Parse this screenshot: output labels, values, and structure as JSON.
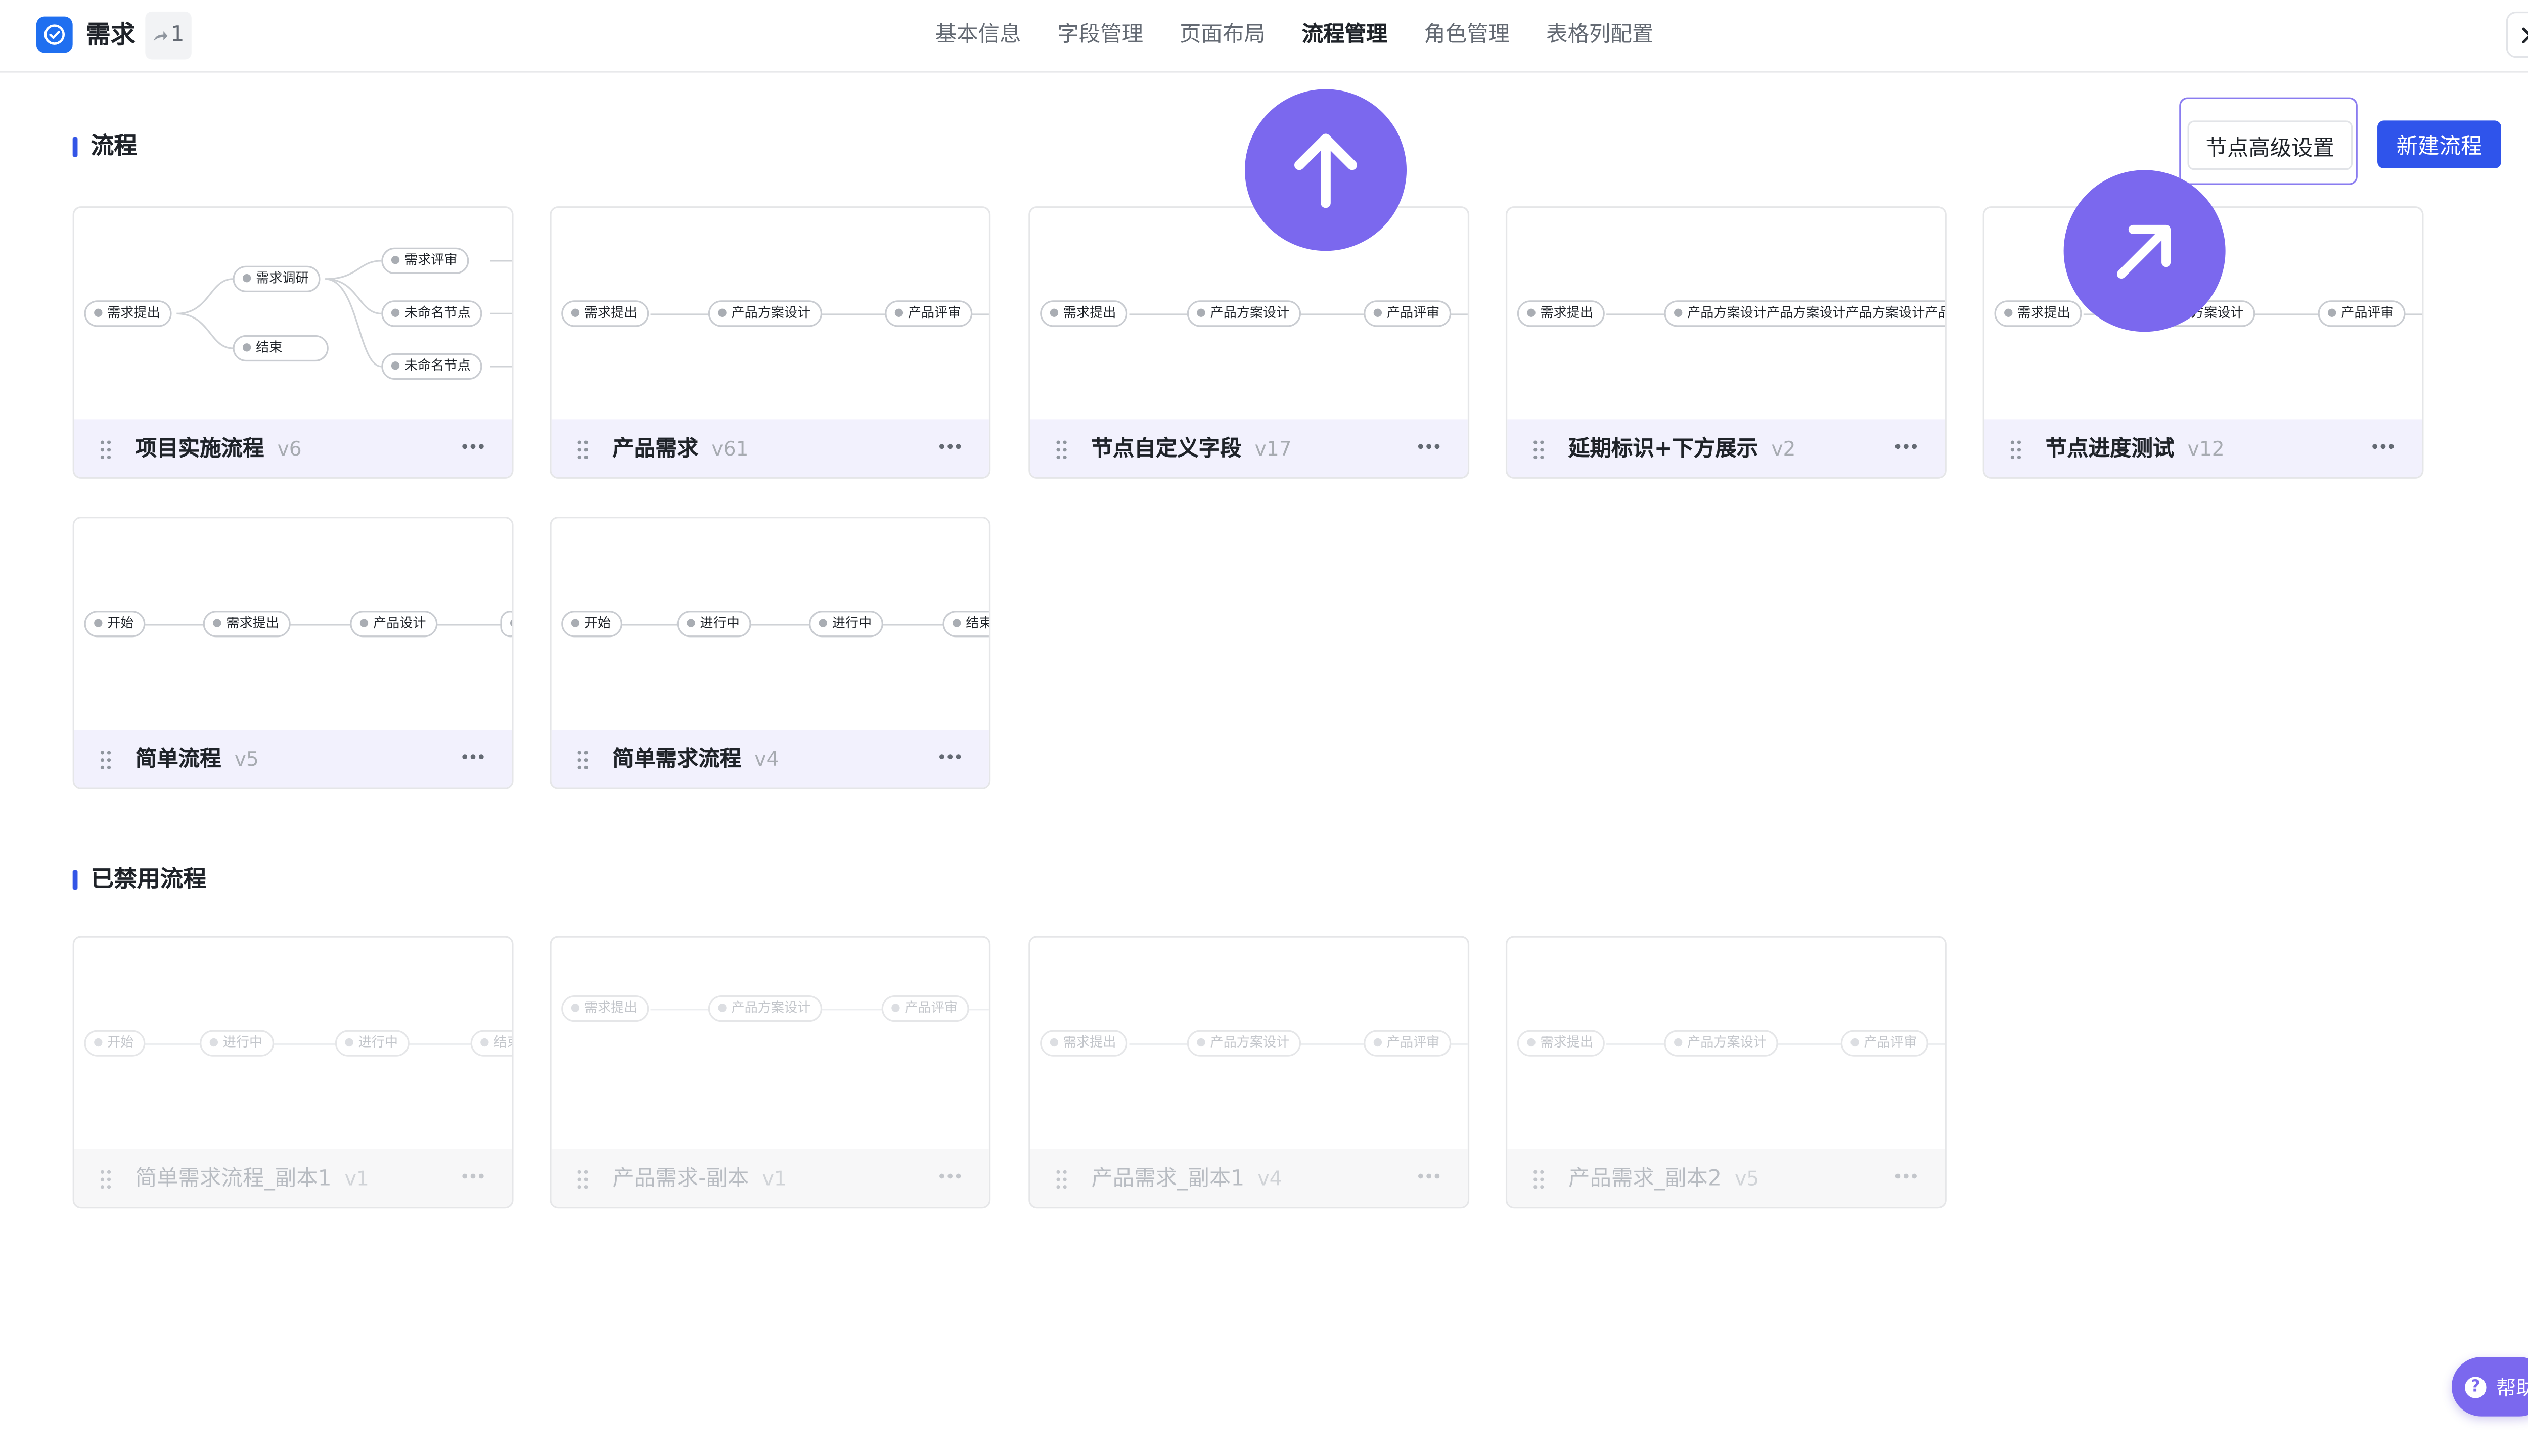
{
  "app": {
    "title": "需求",
    "share_count": "1"
  },
  "tabs": [
    {
      "label": "基本信息"
    },
    {
      "label": "字段管理"
    },
    {
      "label": "页面布局"
    },
    {
      "label": "流程管理"
    },
    {
      "label": "角色管理"
    },
    {
      "label": "表格列配置"
    }
  ],
  "active_tab": "流程管理",
  "sections": {
    "active": "流程",
    "disabled": "已禁用流程"
  },
  "buttons": {
    "advanced": "节点高级设置",
    "new_flow": "新建流程",
    "help": "帮助"
  },
  "flows": [
    {
      "name": "项目实施流程",
      "version": "v6",
      "nodes": [
        "需求提出",
        "需求调研",
        "结束",
        "需求评审",
        "未命名节点",
        "未命名节点"
      ]
    },
    {
      "name": "产品需求",
      "version": "v61",
      "nodes": [
        "需求提出",
        "产品方案设计",
        "产品评审"
      ]
    },
    {
      "name": "节点自定义字段",
      "version": "v17",
      "nodes": [
        "需求提出",
        "产品方案设计",
        "产品评审"
      ]
    },
    {
      "name": "延期标识+下方展示",
      "version": "v2",
      "nodes": [
        "需求提出",
        "产品方案设计产品方案设计产品方案设计产品方案设计"
      ]
    },
    {
      "name": "节点进度测试",
      "version": "v12",
      "nodes": [
        "需求提出",
        "产品方案设计",
        "产品评审"
      ]
    },
    {
      "name": "简单流程",
      "version": "v5",
      "nodes": [
        "开始",
        "需求提出",
        "产品设计"
      ]
    },
    {
      "name": "简单需求流程",
      "version": "v4",
      "nodes": [
        "开始",
        "进行中",
        "进行中",
        "结束"
      ]
    }
  ],
  "disabled_flows": [
    {
      "name": "简单需求流程_副本1",
      "version": "v1",
      "nodes": [
        "开始",
        "进行中",
        "进行中",
        "结束"
      ]
    },
    {
      "name": "产品需求-副本",
      "version": "v1",
      "nodes": [
        "需求提出",
        "产品方案设计",
        "产品评审"
      ]
    },
    {
      "name": "产品需求_副本1",
      "version": "v4",
      "nodes": [
        "需求提出",
        "产品方案设计",
        "产品评审"
      ]
    },
    {
      "name": "产品需求_副本2",
      "version": "v5",
      "nodes": [
        "需求提出",
        "产品方案设计",
        "产品评审"
      ]
    }
  ],
  "icons": {
    "logo": "check-circle-icon",
    "share": "share-arrow-icon",
    "close": "close-icon",
    "drag": "drag-handle-icon",
    "more": "more-horizontal-icon",
    "help": "question-circle-icon",
    "fab_up": "arrow-up-icon",
    "fab_upright": "arrow-up-right-icon"
  },
  "colors": {
    "primary": "#2f54eb",
    "accent_purple": "#7b68ee",
    "card_footer": "#f2f1fd",
    "section_bar": "#3355e6"
  }
}
